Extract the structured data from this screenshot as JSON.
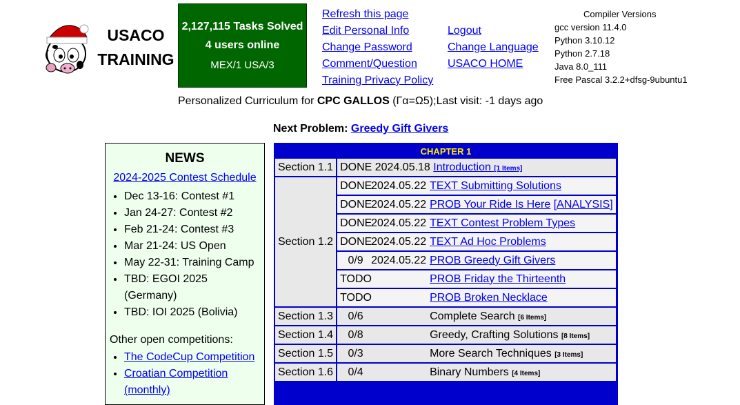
{
  "header": {
    "brand_line1": "USACO",
    "brand_line2": "TRAINING",
    "stats": {
      "tasks_solved": "2,127,115 Tasks Solved",
      "users_online": "4 users online",
      "countries": "MEX/1 USA/3"
    },
    "links_left": [
      "Refresh this page",
      "Edit Personal Info",
      "Change Password",
      "Comment/Question",
      "Training Privacy Policy"
    ],
    "links_right": [
      "Logout",
      "Change Language",
      "USACO HOME"
    ],
    "compilers": {
      "title": "Compiler Versions",
      "items": [
        "gcc version 11.4.0",
        "Python 3.10.12",
        "Python 2.7.18",
        "Java 8.0_111",
        "Free Pascal 3.2.2+dfsg-9ubuntu1"
      ]
    }
  },
  "curriculum": {
    "prefix": "Personalized Curriculum for ",
    "user": "CPC GALLOS",
    "suffix": " (Γα=Ω5);Last visit: -1 days ago"
  },
  "next_problem": {
    "label": "Next Problem: ",
    "link": "Greedy Gift Givers"
  },
  "news": {
    "title": "NEWS",
    "schedule_link": "2024-2025 Contest Schedule",
    "items": [
      "Dec 13-16: Contest #1",
      "Jan 24-27: Contest #2",
      "Feb 21-24: Contest #3",
      "Mar 21-24: US Open",
      "May 22-31: Training Camp",
      "TBD: EGOI 2025 (Germany)",
      "TBD: IOI 2025 (Bolivia)"
    ],
    "other_label": "Other open competitions:",
    "competitions": [
      "The CodeCup Competition",
      "Croatian Competition (monthly)"
    ]
  },
  "chapter": {
    "title": "CHAPTER 1",
    "s11": {
      "section": "Section 1.1",
      "status": "DONE",
      "date": "2024.05.18",
      "link": "Introduction ",
      "items": "[1 Items]"
    },
    "s12": {
      "section": "Section 1.2",
      "rows": [
        {
          "status": "DONE",
          "date": "2024.05.22",
          "link": "TEXT Submitting Solutions"
        },
        {
          "status": "DONE",
          "date": "2024.05.22",
          "link": "PROB Your Ride Is Here",
          "extra": "[ANALYSIS]"
        },
        {
          "status": "DONE",
          "date": "2024.05.22",
          "link": "TEXT Contest Problem Types"
        },
        {
          "status": "DONE",
          "date": "2024.05.22",
          "link": "TEXT Ad Hoc Problems"
        },
        {
          "status": "0/9",
          "date": "2024.05.22",
          "link": "PROB Greedy Gift Givers"
        },
        {
          "status": "TODO",
          "date": "",
          "link": "PROB Friday the Thirteenth"
        },
        {
          "status": "TODO",
          "date": "",
          "link": "PROB Broken Necklace"
        }
      ]
    },
    "sections": [
      {
        "section": "Section 1.3",
        "progress": "0/6",
        "name": "Complete Search ",
        "items": "[6 Items]"
      },
      {
        "section": "Section 1.4",
        "progress": "0/8",
        "name": "Greedy, Crafting Solutions ",
        "items": "[8 Items]"
      },
      {
        "section": "Section 1.5",
        "progress": "0/3",
        "name": "More Search Techniques ",
        "items": "[3 Items]"
      },
      {
        "section": "Section 1.6",
        "progress": "0/4",
        "name": "Binary Numbers ",
        "items": "[4 Items]"
      }
    ]
  },
  "colors": {
    "stats_bg": "#006600",
    "chapter_bg": "#0000cc",
    "chapter_title": "#ffee00",
    "news_bg": "#eeffee",
    "link": "#0000ee"
  }
}
